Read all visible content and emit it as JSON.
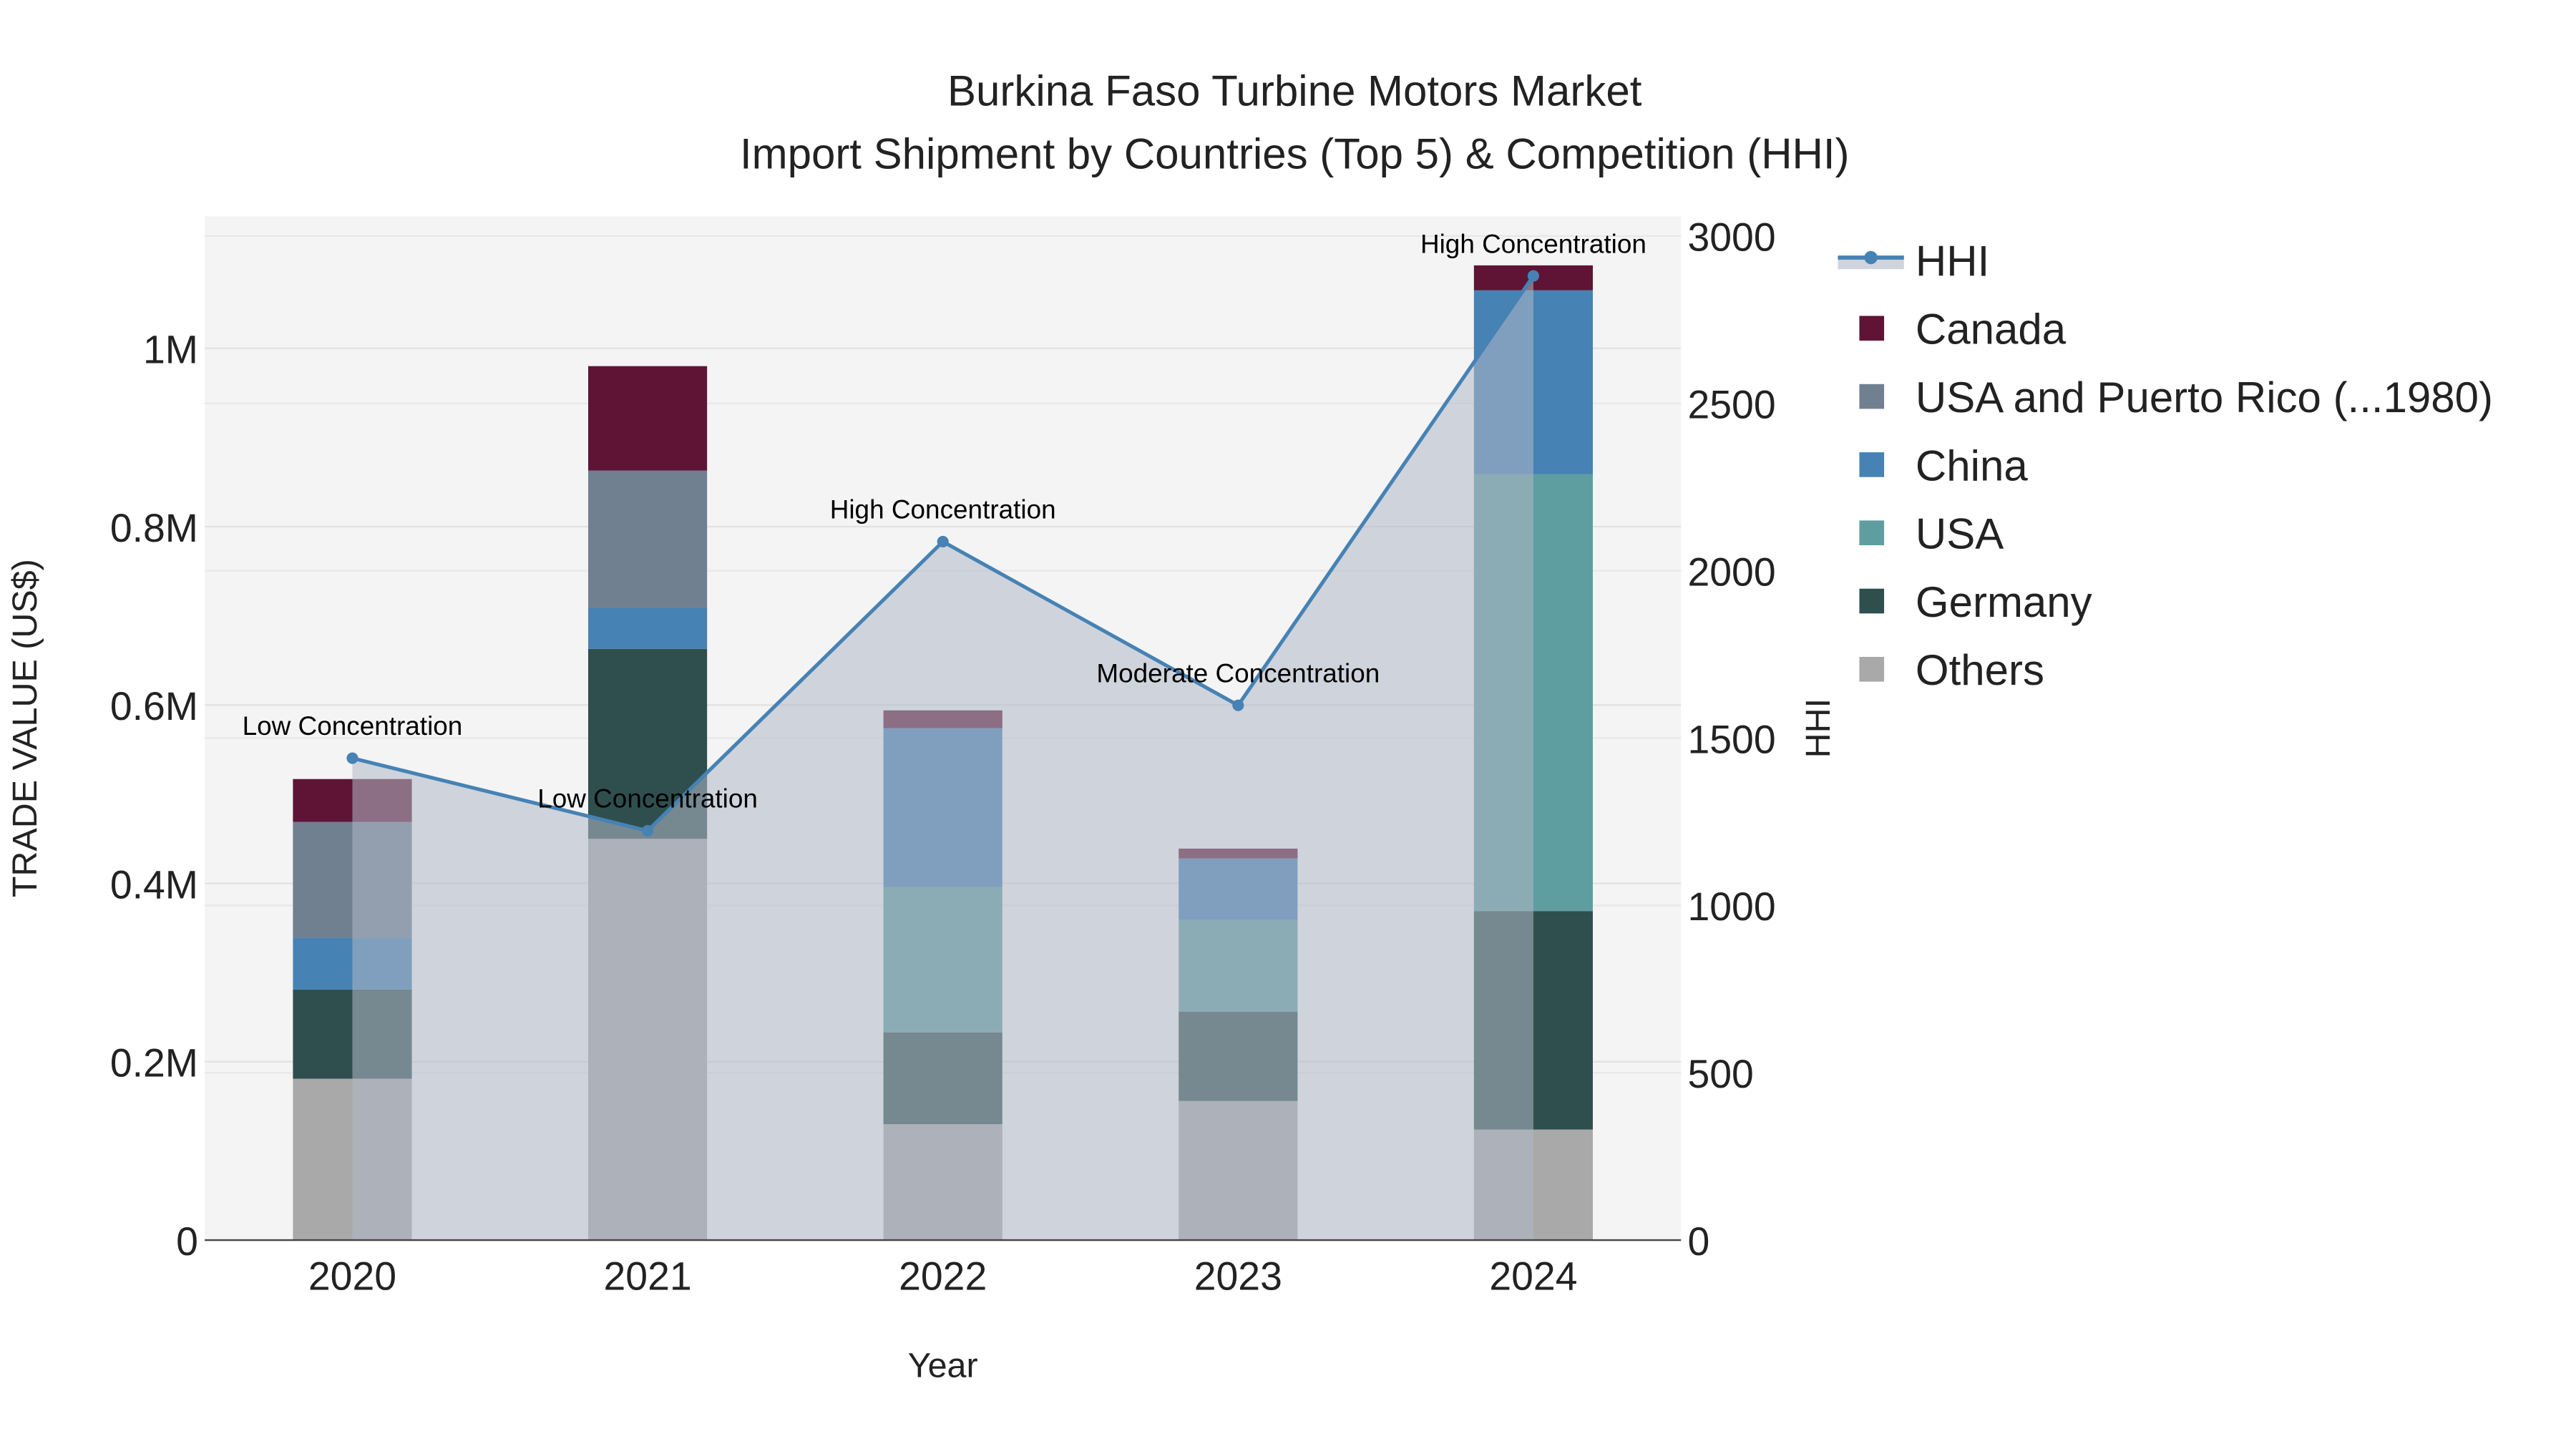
{
  "chart_data": {
    "type": "bar",
    "stacked": true,
    "title": "Burkina Faso Turbine Motors Market",
    "subtitle": "Import Shipment by Countries (Top 5) & Competition (HHI)",
    "xlabel": "Year",
    "ylabel": "TRADE VALUE (US$)",
    "y2label": "HHI",
    "categories": [
      "2020",
      "2021",
      "2022",
      "2023",
      "2024"
    ],
    "ylim": [
      0,
      1148000
    ],
    "y2lim": [
      0,
      3059
    ],
    "yticks": [
      {
        "v": 0,
        "label": "0"
      },
      {
        "v": 200000,
        "label": "0.2M"
      },
      {
        "v": 400000,
        "label": "0.4M"
      },
      {
        "v": 600000,
        "label": "0.6M"
      },
      {
        "v": 800000,
        "label": "0.8M"
      },
      {
        "v": 1000000,
        "label": "1M"
      }
    ],
    "y2ticks": [
      {
        "v": 0,
        "label": "0"
      },
      {
        "v": 500,
        "label": "500"
      },
      {
        "v": 1000,
        "label": "1000"
      },
      {
        "v": 1500,
        "label": "1500"
      },
      {
        "v": 2000,
        "label": "2000"
      },
      {
        "v": 2500,
        "label": "2500"
      },
      {
        "v": 3000,
        "label": "3000"
      }
    ],
    "series": [
      {
        "name": "Others",
        "color": "#a9a9a9",
        "values": [
          181000,
          450000,
          130000,
          156000,
          124000
        ]
      },
      {
        "name": "Germany",
        "color": "#2f4f4f",
        "values": [
          100000,
          213000,
          103000,
          100000,
          245000
        ]
      },
      {
        "name": "USA",
        "color": "#5f9ea0",
        "values": [
          0,
          0,
          163000,
          103000,
          490000
        ]
      },
      {
        "name": "China",
        "color": "#4682b4",
        "values": [
          58000,
          46000,
          178000,
          69000,
          206000
        ]
      },
      {
        "name": "USA and Puerto Rico (...1980)",
        "color": "#708090",
        "values": [
          130000,
          154000,
          0,
          0,
          0
        ]
      },
      {
        "name": "Canada",
        "color": "#5f1435",
        "values": [
          48000,
          117000,
          20000,
          11000,
          28000
        ]
      }
    ],
    "hhi": {
      "name": "HHI",
      "color": "#4682b4",
      "values": [
        1440,
        1223,
        2087,
        1598,
        2881
      ]
    },
    "annotations": [
      "Low Concentration",
      "Low Concentration",
      "High Concentration",
      "Moderate Concentration",
      "High Concentration"
    ],
    "legend_order": [
      "HHI",
      "Canada",
      "USA and Puerto Rico (...1980)",
      "China",
      "USA",
      "Germany",
      "Others"
    ],
    "legend_position": "right",
    "grid": true
  }
}
